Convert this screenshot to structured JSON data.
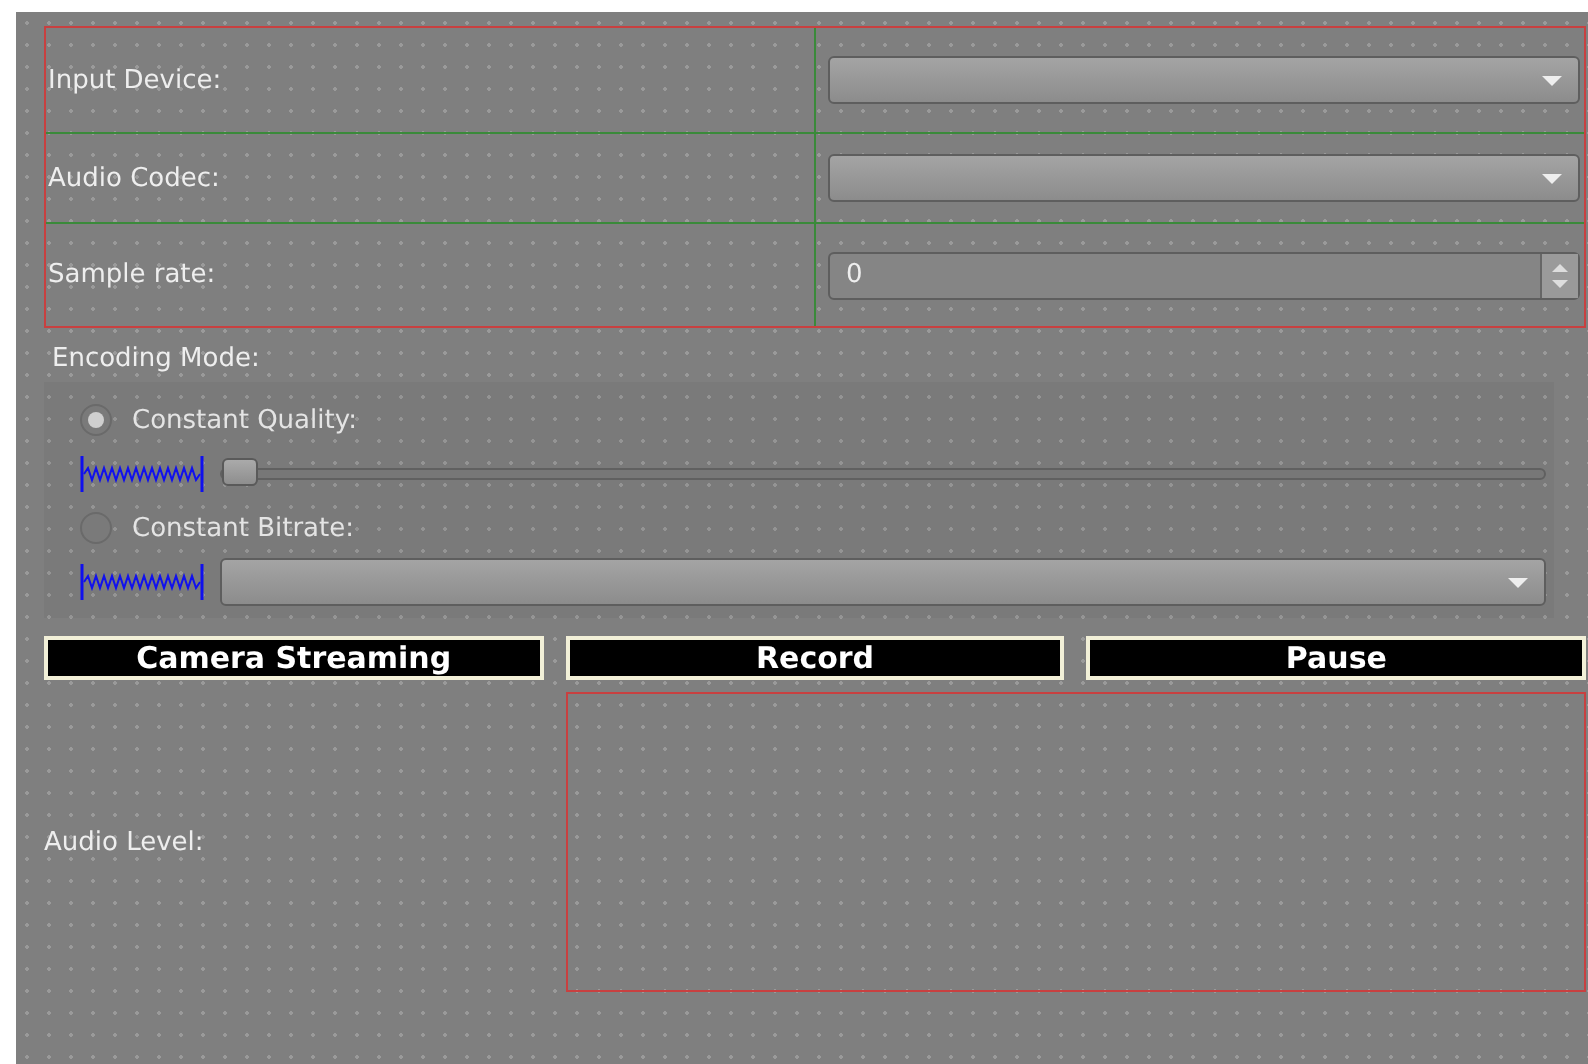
{
  "form": {
    "rows": [
      {
        "label": "Input Device:",
        "kind": "combo"
      },
      {
        "label": "Audio Codec:",
        "kind": "combo"
      },
      {
        "label": "Sample rate:",
        "kind": "spin",
        "value": "0"
      }
    ]
  },
  "encoding": {
    "title": "Encoding Mode:",
    "options": [
      {
        "label": "Constant Quality:",
        "selected": true,
        "kind": "slider",
        "level": 0
      },
      {
        "label": "Constant Bitrate:",
        "selected": false,
        "kind": "combo"
      }
    ]
  },
  "buttons": [
    "Camera Streaming",
    "Record",
    "Pause"
  ],
  "audio_level": {
    "label": "Audio Level:"
  }
}
